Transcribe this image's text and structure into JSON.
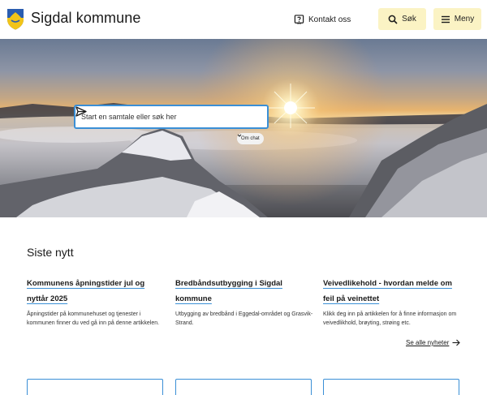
{
  "header": {
    "site_name": "Sigdal kommune",
    "contact_label": "Kontakt oss",
    "search_label": "Søk",
    "menu_label": "Meny",
    "colors": {
      "button_bg": "#fbf3c4",
      "accent": "#3a8fd6"
    }
  },
  "hero": {
    "chat_placeholder": "Start en samtale eller søk her",
    "about_chat_label": "Om chat"
  },
  "news": {
    "heading": "Siste nytt",
    "items": [
      {
        "title": "Kommunens åpningstider jul og nyttår 2025",
        "description": "Åpningstider på kommunehuset og tjenester i kommunen finner du ved gå inn på denne artikkelen."
      },
      {
        "title": "Bredbåndsutbygging i Sigdal kommune",
        "description": "Utbygging av bredbånd i Eggedal-området og Grasvik-Strand."
      },
      {
        "title": "Veivedlikehold - hvordan melde om feil på veinettet",
        "description": "Klikk deg inn på artikkelen for å finne informasjon om veivedlikhold, brøyting, strøing etc."
      }
    ],
    "see_all_label": "Se alle nyheter"
  }
}
